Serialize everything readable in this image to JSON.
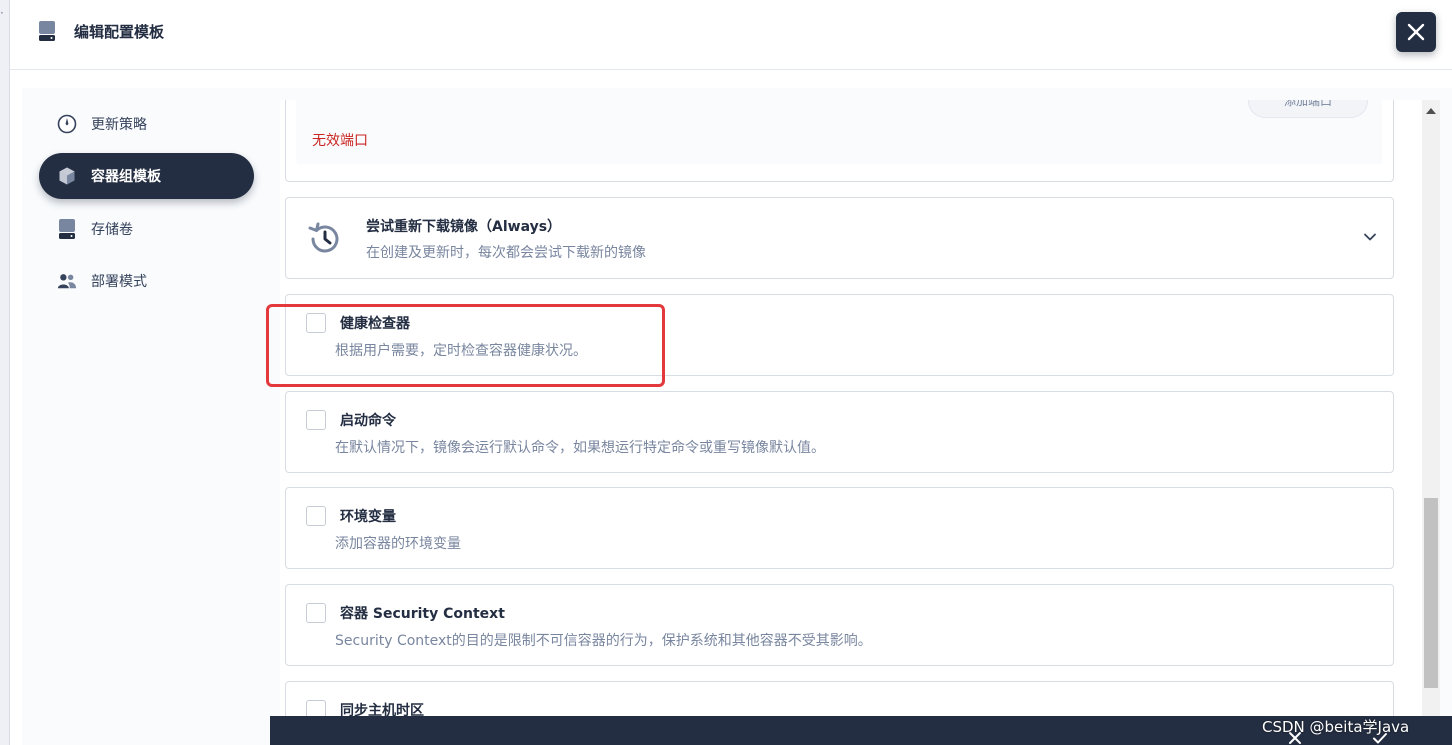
{
  "header": {
    "title": "编辑配置模板"
  },
  "nav": {
    "items": [
      {
        "label": "更新策略",
        "icon": "update-strategy-icon",
        "active": false
      },
      {
        "label": "容器组模板",
        "icon": "pod-template-icon",
        "active": true
      },
      {
        "label": "存储卷",
        "icon": "storage-volume-icon",
        "active": false
      },
      {
        "label": "部署模式",
        "icon": "deploy-mode-icon",
        "active": false
      }
    ]
  },
  "ports": {
    "add_button": "添加端口",
    "invalid_text": "无效端口"
  },
  "image_pull": {
    "title": "尝试重新下载镜像（Always）",
    "description": "在创建及更新时，每次都会尝试下载新的镜像"
  },
  "options": [
    {
      "title": "健康检查器",
      "description": "根据用户需要，定时检查容器健康状况。",
      "checked": false
    },
    {
      "title": "启动命令",
      "description": "在默认情况下，镜像会运行默认命令，如果想运行特定命令或重写镜像默认值。",
      "checked": false
    },
    {
      "title": "环境变量",
      "description": "添加容器的环境变量",
      "checked": false
    },
    {
      "title": "容器 Security Context",
      "description": "Security Context的目的是限制不可信容器的行为，保护系统和其他容器不受其影响。",
      "checked": false
    },
    {
      "title": "同步主机时区",
      "description": "",
      "checked": false
    }
  ],
  "watermark": "CSDN @beita学Java",
  "colors": {
    "primary_dark": "#242e42",
    "error": "#ca2621",
    "highlight": "#e3393c"
  }
}
